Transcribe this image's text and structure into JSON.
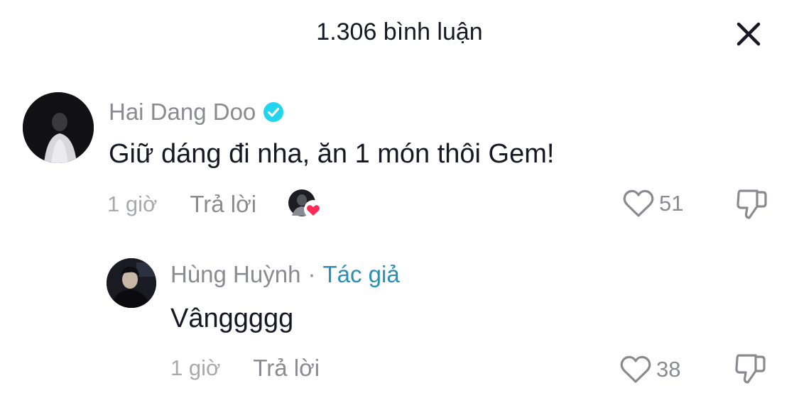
{
  "header": {
    "title": "1.306 bình luận",
    "close_icon": "close-icon"
  },
  "comments": [
    {
      "username": "Hai Dang Doo",
      "verified": true,
      "text": "Giữ dáng đi nha, ăn 1 món thôi Gem!",
      "time": "1 giờ",
      "reply_label": "Trả lời",
      "creator_liked": true,
      "likes": "51"
    }
  ],
  "replies": [
    {
      "username": "Hùng Huỳnh",
      "separator": "·",
      "author_tag": "Tác giả",
      "text": "Vânggggg",
      "time": "1 giờ",
      "reply_label": "Trả lời",
      "likes": "38"
    }
  ],
  "colors": {
    "text_primary": "#161823",
    "text_secondary": "#8a8b91",
    "text_tertiary": "#a8a9ad",
    "author_tag": "#2a8fb5",
    "verified_badge": "#20d5ec",
    "heart_badge": "#fe2c55"
  }
}
